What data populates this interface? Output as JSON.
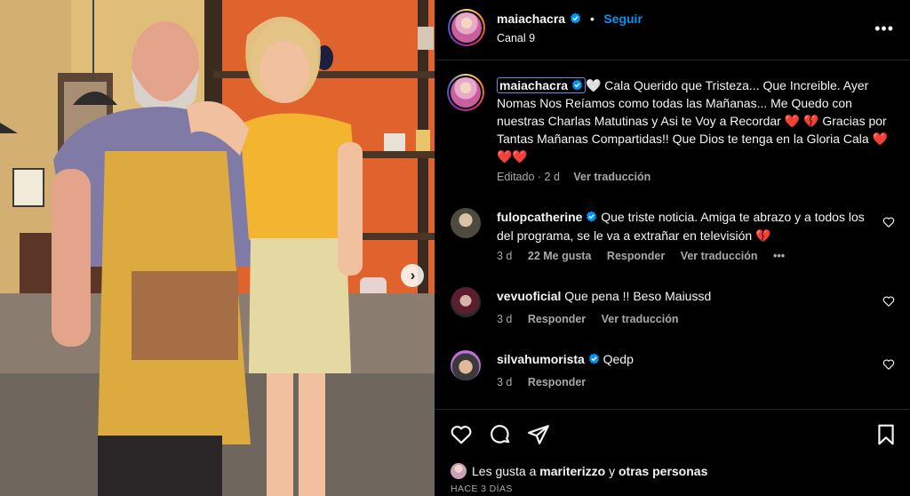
{
  "post": {
    "username": "maiachacra",
    "separator": "•",
    "follow_label": "Seguir",
    "subtitle": "Canal 9",
    "more_icon": "more-horizontal-icon"
  },
  "caption": {
    "username": "maiachacra",
    "emoji_white_heart": "🤍",
    "text": " Cala Querido que Tristeza... Que Increible. Ayer Nomas Nos Reíamos como todas las Mañanas... Me Quedo con nuestras Charlas Matutinas y Asi te Voy a Recordar ❤️ 💔 Gracias por Tantas Mañanas Compartidas!! Que Dios te tenga en la Gloria Cala ❤️❤️❤️",
    "edited_label": "Editado",
    "time": "2 d",
    "translate_label": "Ver traducción"
  },
  "comments": [
    {
      "username": "fulopcatherine",
      "text": "Que triste noticia. Amiga te abrazo y a todos los del programa, se le va a extrañar en televisión 💔",
      "time": "3 d",
      "likes": "22 Me gusta",
      "reply_label": "Responder",
      "translate_label": "Ver traducción",
      "options": "•••"
    },
    {
      "username": "vevuoficial",
      "text": "Que pena !! Beso Maiussd",
      "time": "3 d",
      "reply_label": "Responder",
      "translate_label": "Ver traducción"
    },
    {
      "username": "silvahumorista",
      "text": "Qedp",
      "time": "3 d",
      "reply_label": "Responder"
    }
  ],
  "likes": {
    "prefix": "Les gusta a",
    "user": "mariterizzo",
    "connector": "y",
    "others": "otras personas"
  },
  "date_label": "HACE 3 DÍAS",
  "colors": {
    "accent": "#0095f6",
    "verified": "#0095f6",
    "background": "#000000",
    "secondary_text": "#a8a8a8"
  }
}
